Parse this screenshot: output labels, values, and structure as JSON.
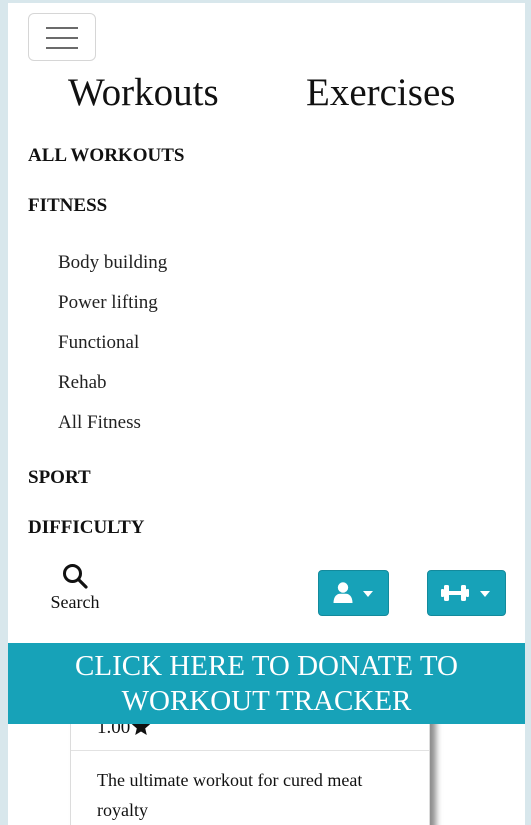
{
  "navbar": {
    "toggler_icon": "hamburger-menu-icon",
    "links": [
      "Workouts",
      "Exercises"
    ]
  },
  "categories": {
    "all_workouts": "ALL WORKOUTS",
    "fitness": "FITNESS",
    "fitness_items": [
      "Body building",
      "Power lifting",
      "Functional",
      "Rehab",
      "All Fitness"
    ],
    "sport": "SPORT",
    "difficulty": "DIFFICULTY"
  },
  "toolbar": {
    "search_label": "Search",
    "search_icon": "search-icon",
    "user_icon": "user-icon",
    "dumbbell_icon": "dumbbell-icon"
  },
  "donate": {
    "line1": "CLICK HERE TO DONATE TO",
    "line2": "WORKOUT TRACKER"
  },
  "workout_card": {
    "rating": "1.00",
    "rating_icon": "star-icon",
    "description": "The ultimate workout for cured meat royalty"
  },
  "colors": {
    "accent": "#17a2b8",
    "background": "#d8e7ec"
  }
}
